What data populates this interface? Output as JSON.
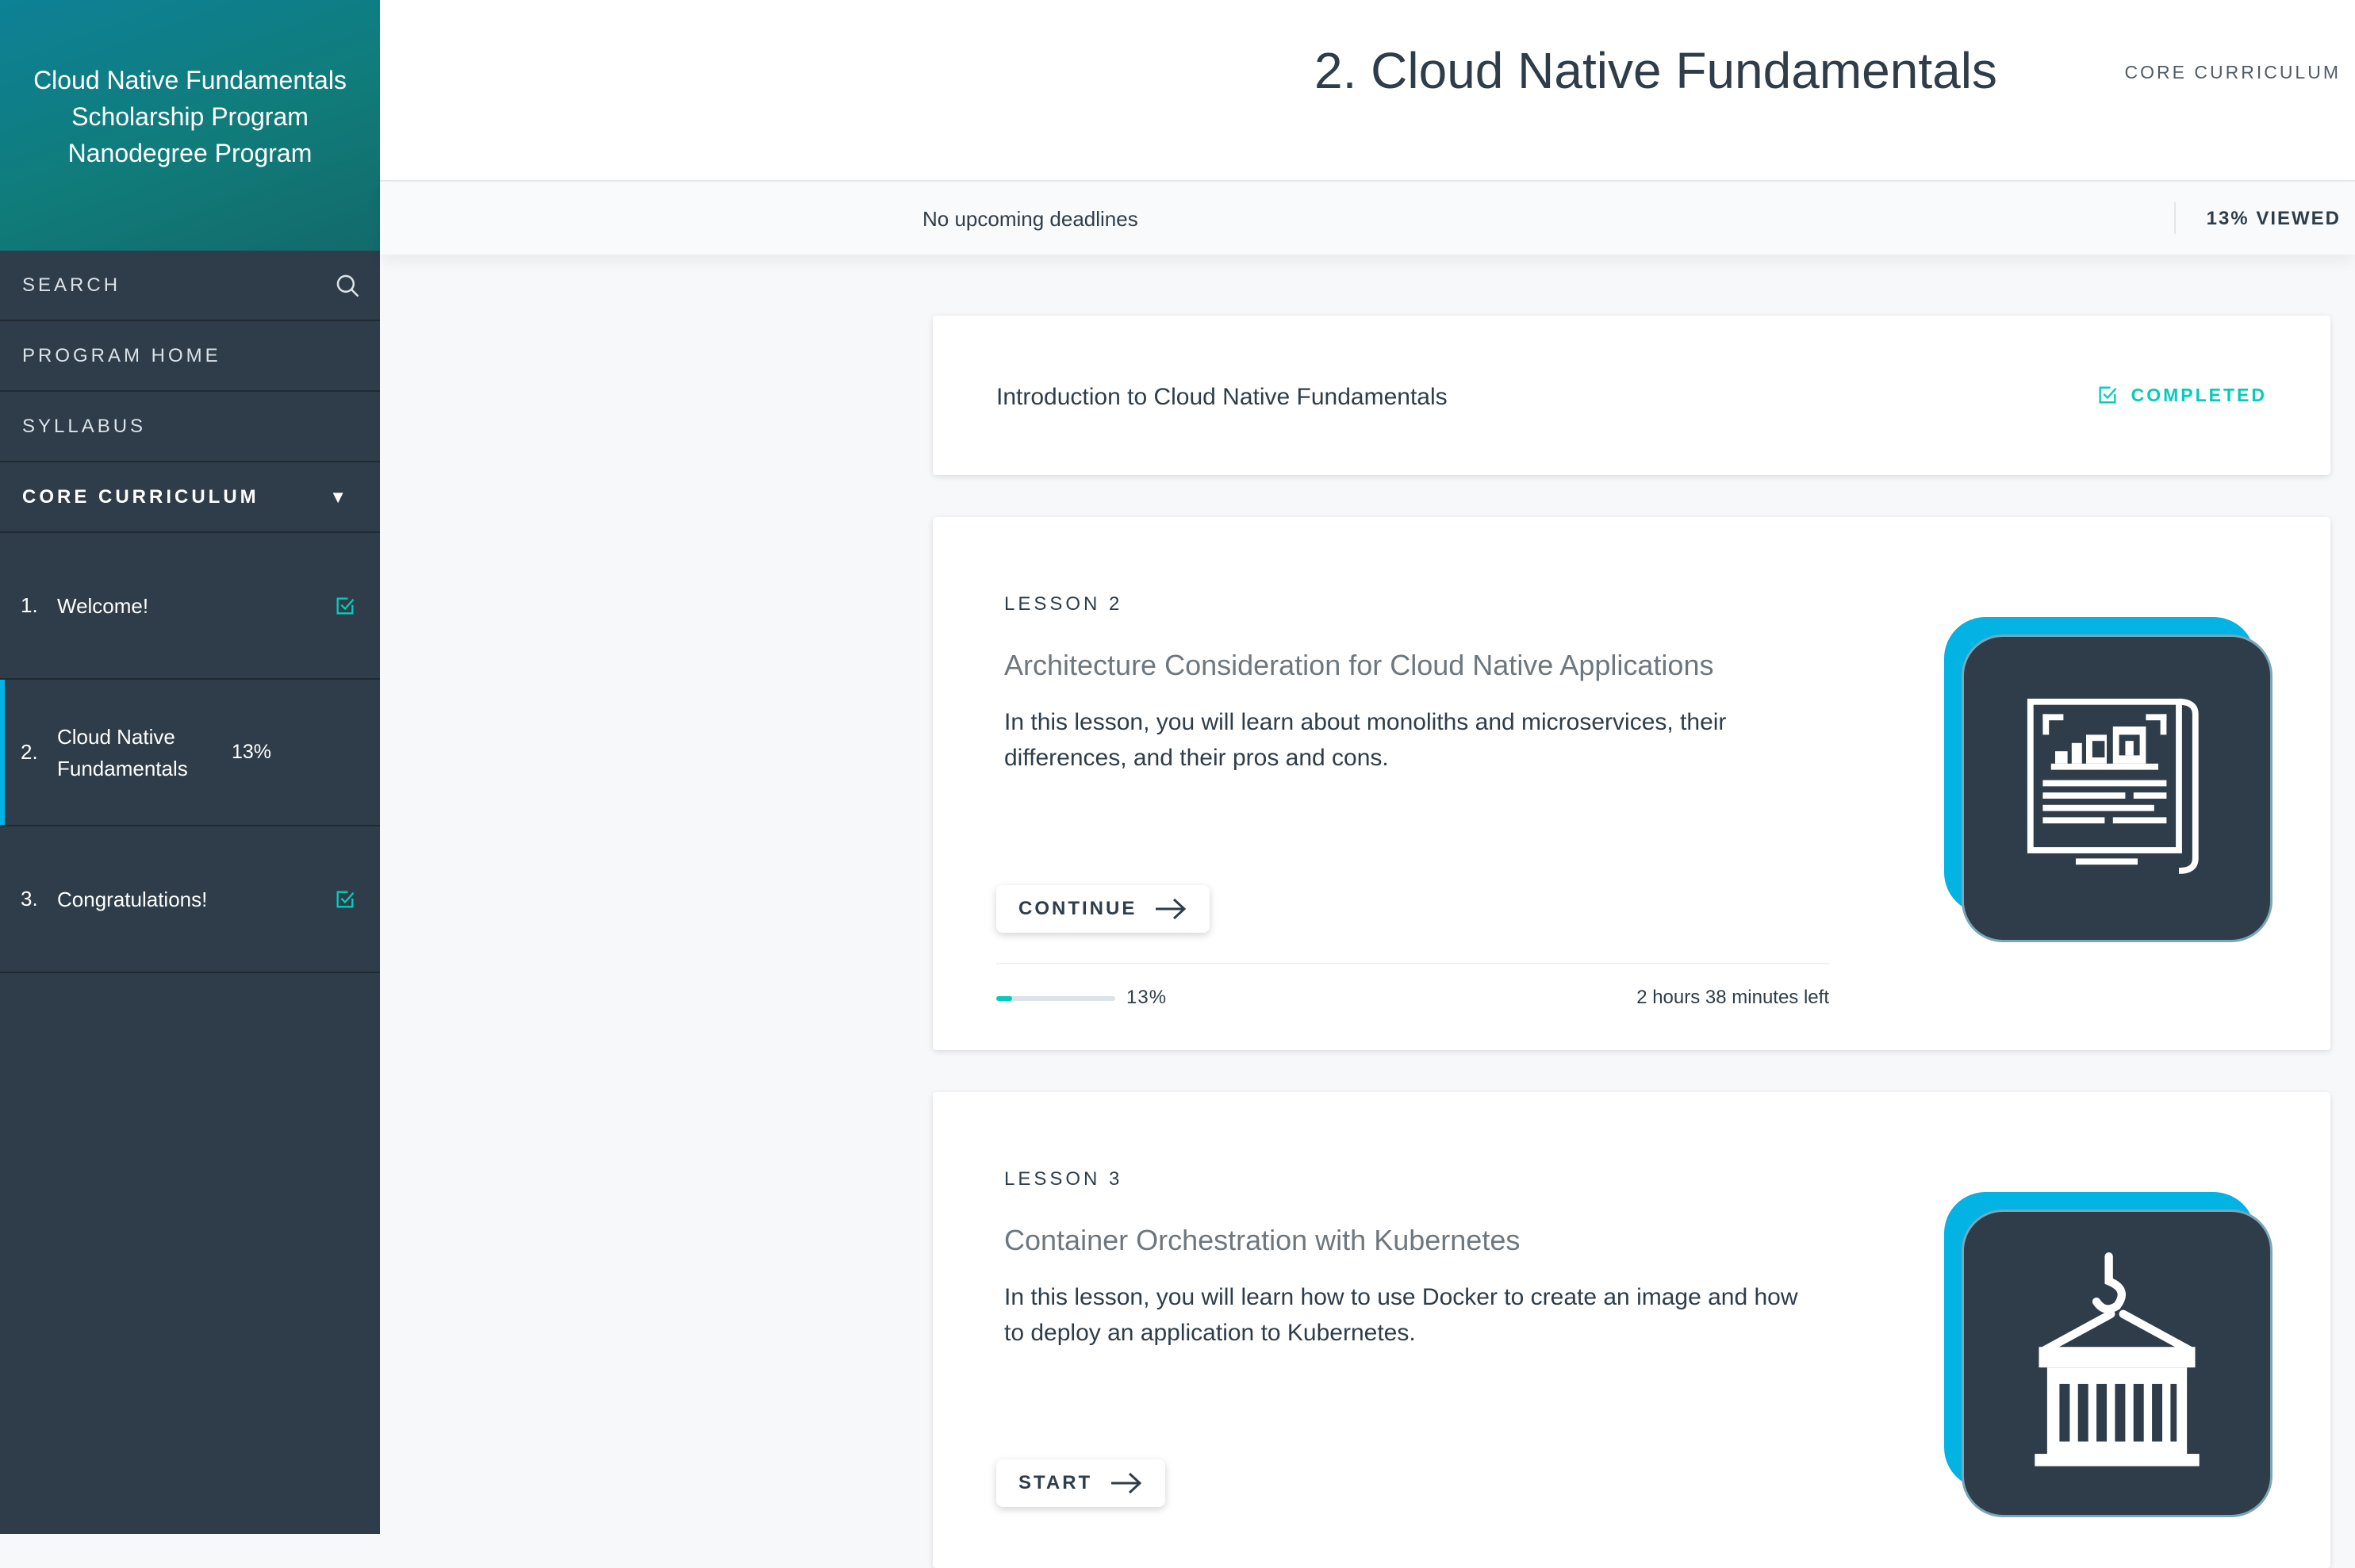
{
  "sidebar": {
    "program_title_lines": [
      "Cloud Native Fundamentals",
      "Scholarship Program",
      "Nanodegree Program"
    ],
    "search_label": "SEARCH",
    "nav": {
      "program_home": "PROGRAM HOME",
      "syllabus": "SYLLABUS",
      "core_curriculum": "CORE CURRICULUM"
    },
    "lessons": [
      {
        "num": "1.",
        "name": "Welcome!",
        "status": "completed"
      },
      {
        "num": "2.",
        "name": "Cloud Native Fundamentals",
        "progress": "13%",
        "status": "active"
      },
      {
        "num": "3.",
        "name": "Congratulations!",
        "status": "completed"
      }
    ]
  },
  "header": {
    "title": "2. Cloud Native Fundamentals",
    "section_label": "CORE CURRICULUM",
    "deadlines": "No upcoming deadlines",
    "viewed": "13% VIEWED"
  },
  "intro_card": {
    "title": "Introduction to Cloud Native Fundamentals",
    "status": "COMPLETED"
  },
  "lessons": [
    {
      "eyebrow": "LESSON 2",
      "title": "Architecture Consideration for Cloud Native Applications",
      "description": "In this lesson, you will learn about monoliths and microservices, their differences, and their pros and cons.",
      "button": "CONTINUE",
      "progress_percent": 13,
      "progress_label": "13%",
      "time_left": "2 hours 38 minutes left",
      "icon": "blueprint-icon"
    },
    {
      "eyebrow": "LESSON 3",
      "title": "Container Orchestration with Kubernetes",
      "description": "In this lesson, you will learn how to use Docker to create an image and how to deploy an application to Kubernetes.",
      "button": "START",
      "icon": "container-crane-icon"
    }
  ],
  "colors": {
    "sidebar_bg": "#2e3d49",
    "accent_teal": "#02ccba",
    "accent_blue": "#02b3e4",
    "header_gradient_start": "#0d8196"
  }
}
